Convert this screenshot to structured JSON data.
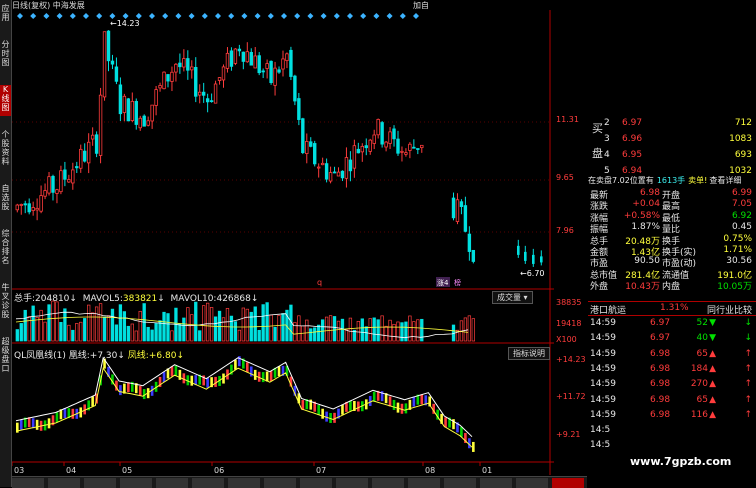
{
  "window": {
    "title": "日线(复权)  中海发展",
    "add_label": "加自"
  },
  "sidebar": {
    "tabs": [
      {
        "label": "应用",
        "active": false
      },
      {
        "label": "分时图",
        "active": false
      },
      {
        "label": "K线图",
        "active": true
      },
      {
        "label": "个股资料",
        "active": false
      },
      {
        "label": "自选股",
        "active": false
      },
      {
        "label": "综合排名",
        "active": false
      },
      {
        "label": "牛叉诊股",
        "active": false
      },
      {
        "label": "超级盘口",
        "active": false
      }
    ]
  },
  "price_panel": {
    "high_label": "14.23",
    "low_label": "6.70",
    "axis_ticks": [
      "11.31",
      "9.65",
      "7.96"
    ],
    "markers": [
      "q",
      "涨4",
      "榜"
    ]
  },
  "volume_panel": {
    "items": [
      {
        "label": "总手:",
        "value": "204810"
      },
      {
        "label": "MAVOL5:",
        "value": "383821"
      },
      {
        "label": "MAVOL10:",
        "value": "426868"
      }
    ],
    "dropdown_label": "成交量",
    "axis_ticks": [
      "38835",
      "19418"
    ],
    "unit_label": "X100"
  },
  "indicator_panel": {
    "title": "QL凤凰线(1)",
    "items": [
      {
        "label": "凰线:",
        "value": "+7.30"
      },
      {
        "label": "凤线:",
        "value": "+6.80"
      }
    ],
    "help_button": "指标说明",
    "axis_ticks": [
      "+14.23",
      "+11.72",
      "+9.21"
    ]
  },
  "x_axis": [
    "03",
    "04",
    "05",
    "06",
    "07",
    "08",
    "01"
  ],
  "order_book": {
    "side_label_top": "买",
    "side_label_bottom": "盘",
    "rows": [
      {
        "level": "2",
        "price": "6.97",
        "volume": "712"
      },
      {
        "level": "3",
        "price": "6.96",
        "volume": "1083"
      },
      {
        "level": "4",
        "price": "6.95",
        "volume": "693"
      },
      {
        "level": "5",
        "price": "6.94",
        "volume": "1032"
      }
    ]
  },
  "big_order": {
    "text": "在卖盘7.02位置有",
    "count": "1613手",
    "link": "卖单!",
    "detail": "查看详细"
  },
  "quote": [
    {
      "l1": "最新",
      "v1": "6.98",
      "c1": "red",
      "l2": "开盘",
      "v2": "6.99",
      "c2": "red"
    },
    {
      "l1": "涨跌",
      "v1": "+0.04",
      "c1": "red",
      "l2": "最高",
      "v2": "7.05",
      "c2": "red"
    },
    {
      "l1": "涨幅",
      "v1": "+0.58%",
      "c1": "red",
      "l2": "最低",
      "v2": "6.92",
      "c2": "green"
    },
    {
      "l1": "振幅",
      "v1": "1.87%",
      "c1": "white",
      "l2": "量比",
      "v2": "0.45",
      "c2": "white"
    },
    {
      "l1": "总手",
      "v1": "20.48万",
      "c1": "yellow",
      "l2": "换手",
      "v2": "0.75%",
      "c2": "yellow"
    },
    {
      "l1": "金额",
      "v1": "1.43亿",
      "c1": "yellow",
      "l2": "换手(实)",
      "v2": "1.71%",
      "c2": "yellow"
    },
    {
      "l1": "市盈",
      "v1": "90.50",
      "c1": "white",
      "l2": "市盈(动)",
      "v2": "30.56",
      "c2": "white"
    },
    {
      "l1": "总市值",
      "v1": "281.4亿",
      "c1": "yellow",
      "l2": "流通值",
      "v2": "191.0亿",
      "c2": "yellow"
    },
    {
      "l1": "外盘",
      "v1": "10.43万",
      "c1": "red",
      "l2": "内盘",
      "v2": "10.05万",
      "c2": "green"
    }
  ],
  "sector": {
    "name": "港口航运",
    "change": "1.31%",
    "compare": "同行业比较"
  },
  "ticks": [
    {
      "time": "14:59",
      "price": "6.97",
      "vol": "52",
      "dir": "down"
    },
    {
      "time": "14:59",
      "price": "6.97",
      "vol": "40",
      "dir": "down"
    },
    {
      "time": "14:59",
      "price": "6.98",
      "vol": "65",
      "dir": "up"
    },
    {
      "time": "14:59",
      "price": "6.98",
      "vol": "184",
      "dir": "up"
    },
    {
      "time": "14:59",
      "price": "6.98",
      "vol": "270",
      "dir": "up"
    },
    {
      "time": "14:59",
      "price": "6.98",
      "vol": "65",
      "dir": "up"
    },
    {
      "time": "14:59",
      "price": "6.98",
      "vol": "116",
      "dir": "up"
    },
    {
      "time": "14:5",
      "price": "",
      "vol": "",
      "dir": ""
    },
    {
      "time": "14:5",
      "price": "",
      "vol": "",
      "dir": ""
    }
  ],
  "watermark": "www.7gpzb.com",
  "colors": {
    "up": "#ff3c3c",
    "down": "#00e0e0",
    "ma_white": "#ffffff",
    "ma_yellow": "#ffff3c"
  }
}
